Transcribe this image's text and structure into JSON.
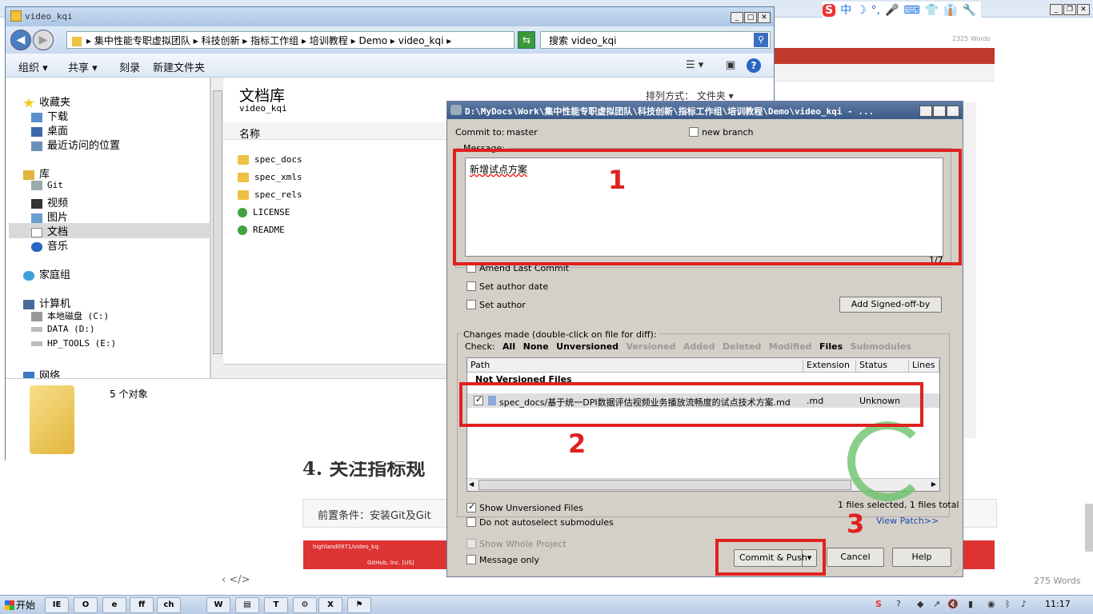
{
  "background": {
    "doc_title": "",
    "words_top": "2325 Words",
    "words_bottom": "275 Words",
    "heading": "4. 关注指标规",
    "precondition": "前置条件：安装Git及Git",
    "inner_browser_tab": "highland0971/video_kq:",
    "inner_browser_url": "GitHub, Inc. [US]",
    "code_icons": "‹   </>",
    "ime_icons": [
      "S",
      "中",
      "☽",
      "°,",
      "🎤",
      "⌨",
      "👕",
      "👔",
      "🔧"
    ]
  },
  "explorer": {
    "title": "video_kqi",
    "address": "▸ 集中性能专职虚拟团队 ▸ 科技创新 ▸ 指标工作组 ▸ 培训教程 ▸ Demo ▸ video_kqi ▸",
    "search_placeholder": "搜索 video_kqi",
    "toolbar": {
      "organize": "组织 ▾",
      "share": "共享 ▾",
      "burn": "刻录",
      "new_folder": "新建文件夹"
    },
    "tree": {
      "favorites": "收藏夹",
      "downloads": "下载",
      "desktop": "桌面",
      "recent": "最近访问的位置",
      "libraries": "库",
      "git": "Git",
      "videos": "视频",
      "pictures": "图片",
      "documents": "文档",
      "music": "音乐",
      "homegroup": "家庭组",
      "computer": "计算机",
      "drive_c": "本地磁盘 (C:)",
      "drive_d": "DATA (D:)",
      "drive_e": "HP_TOOLS (E:)",
      "network": "网络"
    },
    "library_title": "文档库",
    "library_sub": "video_kqi",
    "arrange_by": "排列方式：  文件夹 ▾",
    "column_name": "名称",
    "files": [
      "spec_docs",
      "spec_xmls",
      "spec_rels",
      "LICENSE",
      "README"
    ],
    "status": "5 个对象"
  },
  "dialog": {
    "title": "D:\\MyDocs\\Work\\集中性能专职虚拟团队\\科技创新\\指标工作组\\培训教程\\Demo\\video_kqi - ...",
    "commit_to_label": "Commit to:",
    "branch": "master",
    "new_branch": "new branch",
    "message_label": "Message:",
    "message": "新增试点方案",
    "counter": "1/7",
    "amend": "Amend Last Commit",
    "set_author_date": "Set author date",
    "set_author": "Set author",
    "signed_off": "Add Signed-off-by",
    "changes_label": "Changes made (double-click on file for diff):",
    "check": {
      "label": "Check:",
      "all": "All",
      "none": "None",
      "unversioned": "Unversioned",
      "versioned": "Versioned",
      "added": "Added",
      "deleted": "Deleted",
      "modified": "Modified",
      "files": "Files",
      "submodules": "Submodules"
    },
    "columns": {
      "path": "Path",
      "extension": "Extension",
      "status": "Status",
      "lines": "Lines a"
    },
    "group": "Not Versioned Files",
    "row": {
      "path": "spec_docs/基于统一DPI数据评估视频业务播放流畅度的试点技术方案.md",
      "ext": ".md",
      "status": "Unknown"
    },
    "show_unversioned": "Show Unversioned Files",
    "no_autoselect": "Do not autoselect submodules",
    "selected_info": "1 files selected, 1 files total",
    "view_patch": "View Patch>>",
    "show_whole": "Show Whole Project",
    "message_only": "Message only",
    "commit_push": "Commit & Push",
    "cancel": "Cancel",
    "help": "Help"
  },
  "annotations": {
    "n1": "1",
    "n2": "2",
    "n3": "3"
  },
  "taskbar": {
    "start": "开始",
    "clock": "11:17",
    "apps": [
      "IE",
      "O",
      "e",
      "ff",
      "ch",
      "W",
      "▤",
      "T",
      "⚙",
      "X",
      "⚑"
    ]
  },
  "colors": {
    "annotation": "#e02020",
    "title_bar": "#3a5a88"
  }
}
